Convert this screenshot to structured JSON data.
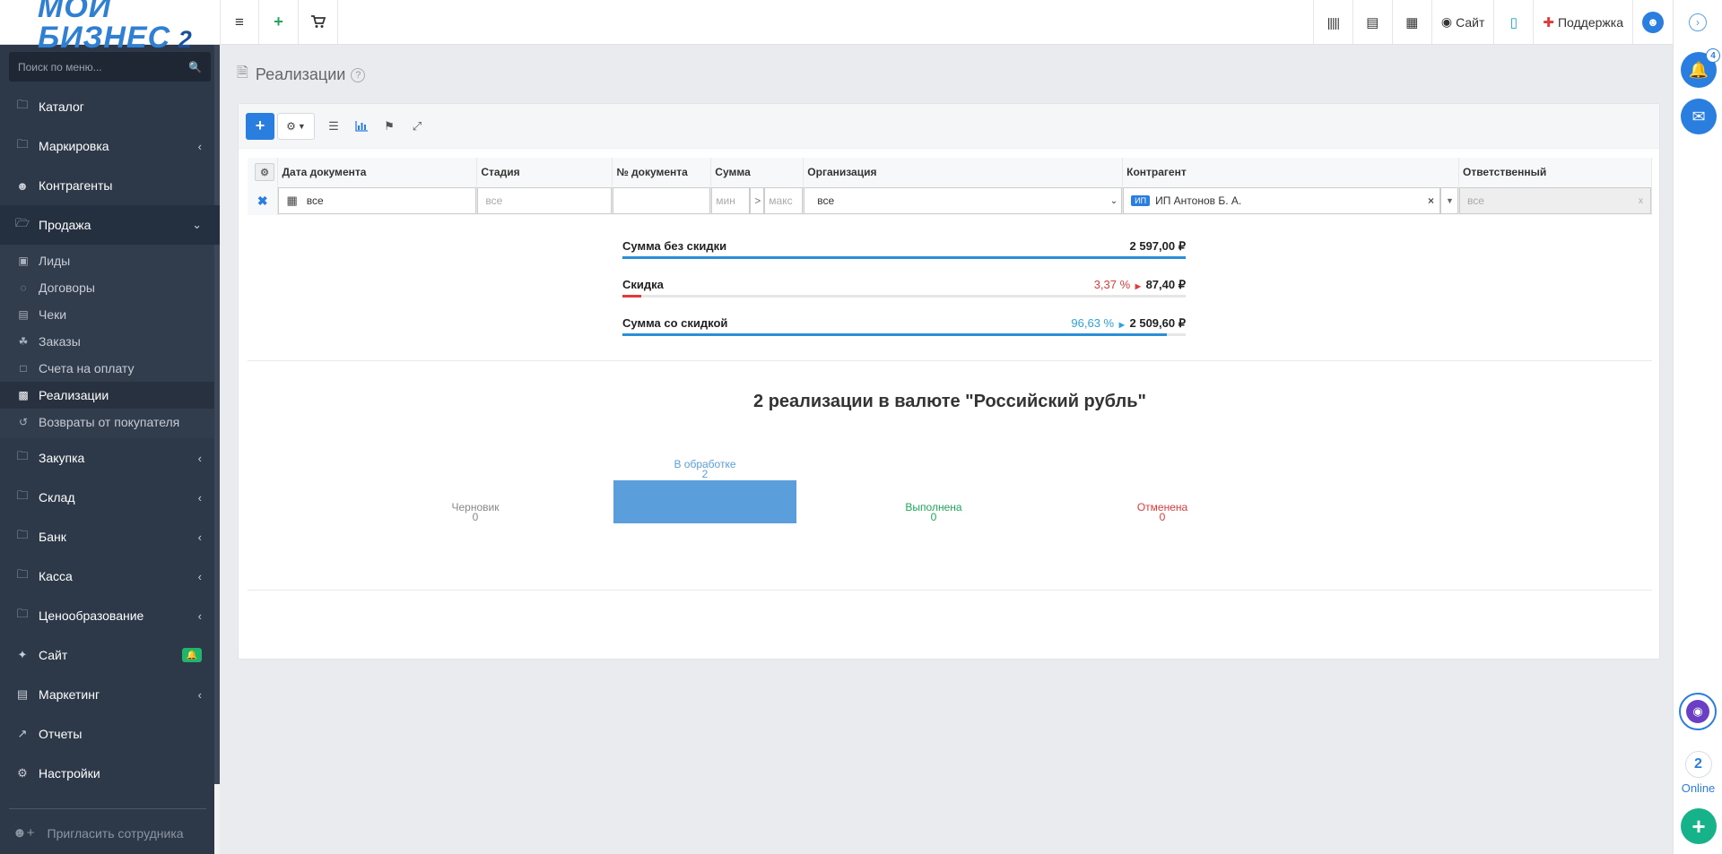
{
  "logo": {
    "line1": "МОЙ",
    "line2": "БИЗНЕС",
    "num": "2"
  },
  "sidebar": {
    "search_placeholder": "Поиск по меню...",
    "items": [
      {
        "label": "Каталог",
        "icon": "folder-icon"
      },
      {
        "label": "Маркировка",
        "icon": "folder-icon"
      },
      {
        "label": "Контрагенты",
        "icon": "users-icon"
      },
      {
        "label": "Продажа",
        "icon": "folder-icon"
      },
      {
        "label": "Закупка",
        "icon": "folder-icon"
      },
      {
        "label": "Склад",
        "icon": "folder-icon"
      },
      {
        "label": "Банк",
        "icon": "folder-icon"
      },
      {
        "label": "Касса",
        "icon": "folder-icon"
      },
      {
        "label": "Ценообразование",
        "icon": "folder-icon"
      },
      {
        "label": "Сайт",
        "icon": "magic-wand-icon"
      },
      {
        "label": "Маркетинг",
        "icon": "bar-chart-icon"
      },
      {
        "label": "Отчеты",
        "icon": "line-chart-icon"
      },
      {
        "label": "Настройки",
        "icon": "gear-icon"
      }
    ],
    "sub_items": [
      {
        "label": "Лиды"
      },
      {
        "label": "Договоры"
      },
      {
        "label": "Чеки"
      },
      {
        "label": "Заказы"
      },
      {
        "label": "Счета на оплату"
      },
      {
        "label": "Реализации"
      },
      {
        "label": "Возвраты от покупателя"
      }
    ],
    "invite": "Пригласить сотрудника"
  },
  "topbar": {
    "site": "Сайт",
    "support": "Поддержка"
  },
  "rail": {
    "notifications": "4",
    "online_count": "2",
    "online_label": "Online"
  },
  "page": {
    "title": "Реализации",
    "help": "?"
  },
  "filters": {
    "headers": [
      "Дата документа",
      "Стадия",
      "№ документа",
      "Сумма",
      "Организация",
      "Контрагент",
      "Ответственный"
    ],
    "date_value": "все",
    "stage_placeholder": "все",
    "sum_min": "мин",
    "sum_sep": ">",
    "sum_max": "макс",
    "org_value": "все",
    "contragent_tag": "ИП",
    "contragent_value": "ИП Антонов Б. А.",
    "responsible_value": "все"
  },
  "summary": {
    "no_discount_label": "Сумма без скидки",
    "no_discount_value": "2 597,00 ₽",
    "discount_label": "Скидка",
    "discount_pct": "3,37 %",
    "discount_value": "87,40 ₽",
    "discount_fraction": 0.0337,
    "with_discount_label": "Сумма со скидкой",
    "with_discount_pct": "96,63 %",
    "with_discount_value": "2 509,60 ₽",
    "with_discount_fraction": 0.9663
  },
  "chart_data": {
    "type": "bar",
    "title": "2 реализации в валюте \"Российский рубль\"",
    "categories": [
      "Черновик",
      "В обработке",
      "Выполнена",
      "Отменена"
    ],
    "values": [
      0,
      2,
      0,
      0
    ],
    "colors": [
      "#888888",
      "#5a9fdb",
      "#1fa85a",
      "#e03a3a"
    ],
    "bar_color": "#5a9fdb"
  }
}
